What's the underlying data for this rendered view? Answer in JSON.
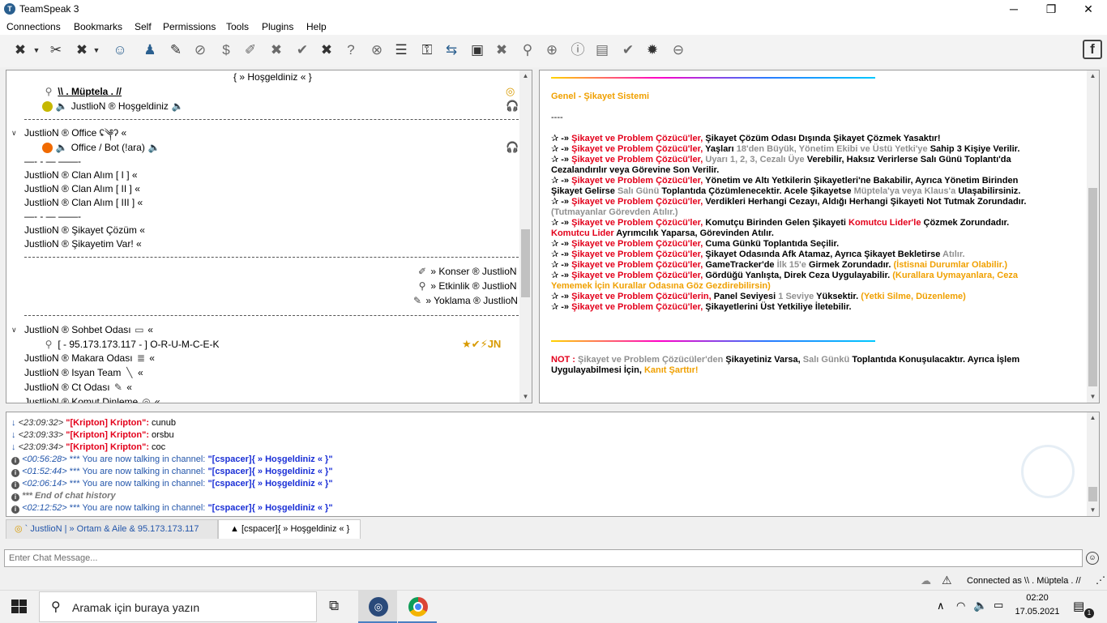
{
  "window": {
    "title": "TeamSpeak 3",
    "minimize": "─",
    "maximize": "❐",
    "close": "✕"
  },
  "menu": [
    "Connections",
    "Bookmarks",
    "Self",
    "Permissions",
    "Tools",
    "Plugins",
    "Help"
  ],
  "tree": {
    "header": "{ » Hoşgeldiniz « }",
    "rows": [
      "\\\\ . Müptela . //",
      "JustlioN ® Hoşgeldiniz",
      "JustlioN ® Office ʢ༆ʔ «",
      "Office / Bot (!ara)",
      "—- - — ——-",
      "JustlioN ® Clan Alım [ I ] «",
      "JustlioN ® Clan Alım [ II ] «",
      "JustlioN ® Clan Alım [ III ] «",
      "—- - — ——-",
      "JustlioN ® Şikayet Çözüm «",
      "JustlioN ® Şikayetim Var! «",
      "» Konser ® JustlioN",
      "» Etkinlik ® JustlioN",
      "» Yoklama ® JustlioN",
      "JustlioN ® Sohbet Odası",
      "[ - 95.173.173.117 - ] O-R-U-M-C-E-K",
      "JustlioN ® Makara Odası",
      "JustlioN ® Isyan Team",
      "JustlioN ® Ct Odası",
      "JustlioN ® Komut Dinleme"
    ],
    "badge": "JN",
    "chevron": "∨"
  },
  "info": {
    "heading": "Genel - Şikayet Sistemi",
    "dashes": "----",
    "bullet": "✰ -»",
    "role": "Şikayet ve Problem Çözücü'ler,",
    "role_genitive": "Şikayet ve Problem Çözücü'lerin,",
    "r1": "Şikayet Çözüm Odası Dışında Şikayet Çözmek Yasaktır!",
    "r2a": "Yaşları",
    "r2b": "18'den Büyük, Yönetim Ekibi ve Üstü Yetki'ye",
    "r2c": "Sahip 3 Kişiye Verilir.",
    "r3a": "Uyarı 1, 2, 3, Cezalı Üye",
    "r3b": "Verebilir, Haksız Verirlerse Salı Günü Toplantı'da",
    "r3c": "Cezalandırılır veya Görevine Son Verilir.",
    "r4a": "Yönetim ve Altı Yetkilerin Şikayetleri'ne Bakabilir, Ayrıca Yönetim Birinden",
    "r4b": "Şikayet Gelirse",
    "r4c": "Salı Günü",
    "r4d": "Toplantıda Çözümlenecektir. Acele Şikayetse",
    "r4e": "Müptela'ya veya Klaus'a",
    "r4f": "Ulaşabilirsiniz.",
    "r5a": "Verdikleri Herhangi Cezayı, Aldığı Herhangi Şikayeti Not Tutmak Zorundadır.",
    "r5b": "(Tutmayanlar Görevden Atılır.)",
    "r6a": "Komutçu Birinden Gelen Şikayeti",
    "r6b": "Komutcu Lider'le",
    "r6c": "Çözmek Zorundadır.",
    "r6d": "Komutcu Lider",
    "r6e": "Ayrımcılık Yaparsa, Görevinden Atılır.",
    "r7": "Cuma Günkü Toplantıda Seçilir.",
    "r8a": "Şikayet Odasında Afk Atamaz, Ayrıca Şikayet Bekletirse",
    "r8b": "Atılır.",
    "r9a": "GameTracker'de",
    "r9b": "İlk 15'e",
    "r9c": "Girmek Zorundadır.",
    "r9d": "(İstisnai Durumlar Olabilir.)",
    "r10a": "Gördüğü Yanlışta, Direk Ceza Uygulayabilir.",
    "r10b": "(Kurallara Uymayanlara, Ceza",
    "r10c": "Yememek İçin Kurallar Odasına Göz Gezdirebilirsin)",
    "r11a": "Panel Seviyesi",
    "r11b": "1 Seviye",
    "r11c": "Yüksektir.",
    "r11d": "(Yetki Silme, Düzenleme)",
    "r12": "Şikayetlerini Üst Yetkiliye İletebilir.",
    "note_label": "NOT :",
    "note_a": "Şikayet ve Problem Çözücüler'den",
    "note_b": "Şikayetiniz Varsa,",
    "note_c": "Salı Günkü",
    "note_d": "Toplantıda Konuşulacaktır. Ayrıca İşlem",
    "note_e": "Uygulayabilmesi İçin,",
    "note_f": "Kanıt Şarttır!"
  },
  "chat": {
    "sender": "\"[Kripton] Kripton\":",
    "lines": [
      {
        "time": "<23:09:32>",
        "text": "cunub"
      },
      {
        "time": "<23:09:33>",
        "text": "orsbu"
      },
      {
        "time": "<23:09:34>",
        "text": "coc"
      }
    ],
    "sys_text": "*** You are now talking in channel:",
    "channel": "\"[cspacer]{ » Hoşgeldiniz « }\"",
    "sys_times": [
      "<00:56:28>",
      "<01:52:44>",
      "<02:06:14>"
    ],
    "end_history": "*** End of chat history",
    "last_time": "<02:12:52>"
  },
  "tabs": {
    "server": "` JustlioN   | » Ortam & Aile & 95.173.173.117",
    "channel": "[cspacer]{ » Hoşgeldiniz « }"
  },
  "input": {
    "placeholder": "Enter Chat Message..."
  },
  "status": {
    "connected": "Connected as \\\\ . Müptela . //"
  },
  "taskbar": {
    "search_placeholder": "Aramak için buraya yazın",
    "time": "02:20",
    "date": "17.05.2021",
    "notif_count": "1"
  },
  "colors": {
    "red": "#e3001b",
    "orange": "#f0a000",
    "gray": "#909090",
    "channel_blue": "#1a2fd6"
  }
}
